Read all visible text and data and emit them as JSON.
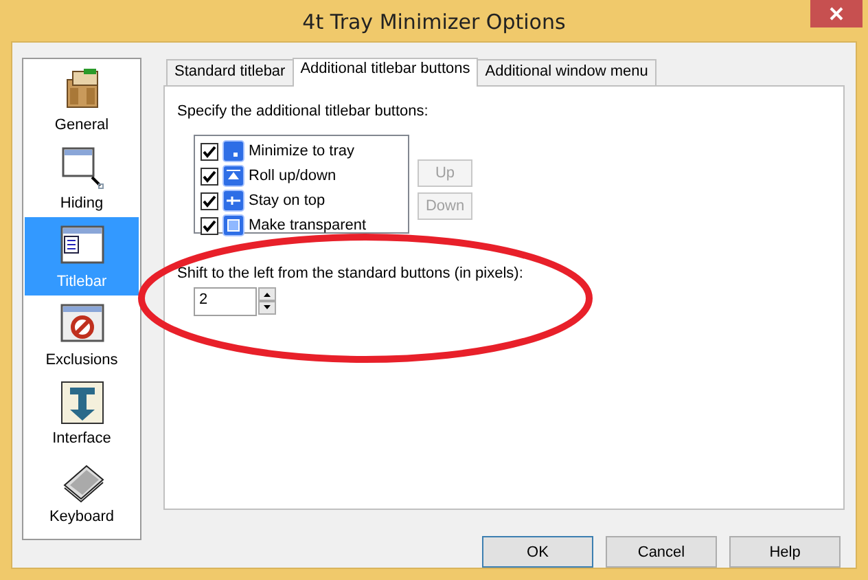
{
  "window": {
    "title": "4t Tray Minimizer Options"
  },
  "sidebar": {
    "items": [
      {
        "label": "General",
        "selected": false
      },
      {
        "label": "Hiding",
        "selected": false
      },
      {
        "label": "Titlebar",
        "selected": true
      },
      {
        "label": "Exclusions",
        "selected": false
      },
      {
        "label": "Interface",
        "selected": false
      },
      {
        "label": "Keyboard",
        "selected": false
      }
    ]
  },
  "tabs": [
    {
      "label": "Standard titlebar",
      "selected": false
    },
    {
      "label": "Additional titlebar buttons",
      "selected": true
    },
    {
      "label": "Additional window menu",
      "selected": false
    }
  ],
  "panel": {
    "prompt": "Specify the additional titlebar buttons:",
    "buttons_list": [
      {
        "label": "Minimize to tray",
        "checked": true
      },
      {
        "label": "Roll up/down",
        "checked": true
      },
      {
        "label": "Stay on top",
        "checked": true
      },
      {
        "label": "Make transparent",
        "checked": true
      }
    ],
    "move_buttons": [
      {
        "label": "Up",
        "disabled": true
      },
      {
        "label": "Down",
        "disabled": true
      }
    ],
    "shift_label": "Shift to the left from the standard buttons (in pixels):",
    "shift_value": "2"
  },
  "annotation": {
    "kind": "ellipse",
    "color": "#e8202a"
  },
  "dialog_buttons": [
    {
      "label": "OK",
      "default": true
    },
    {
      "label": "Cancel",
      "default": false
    },
    {
      "label": "Help",
      "default": false
    }
  ]
}
